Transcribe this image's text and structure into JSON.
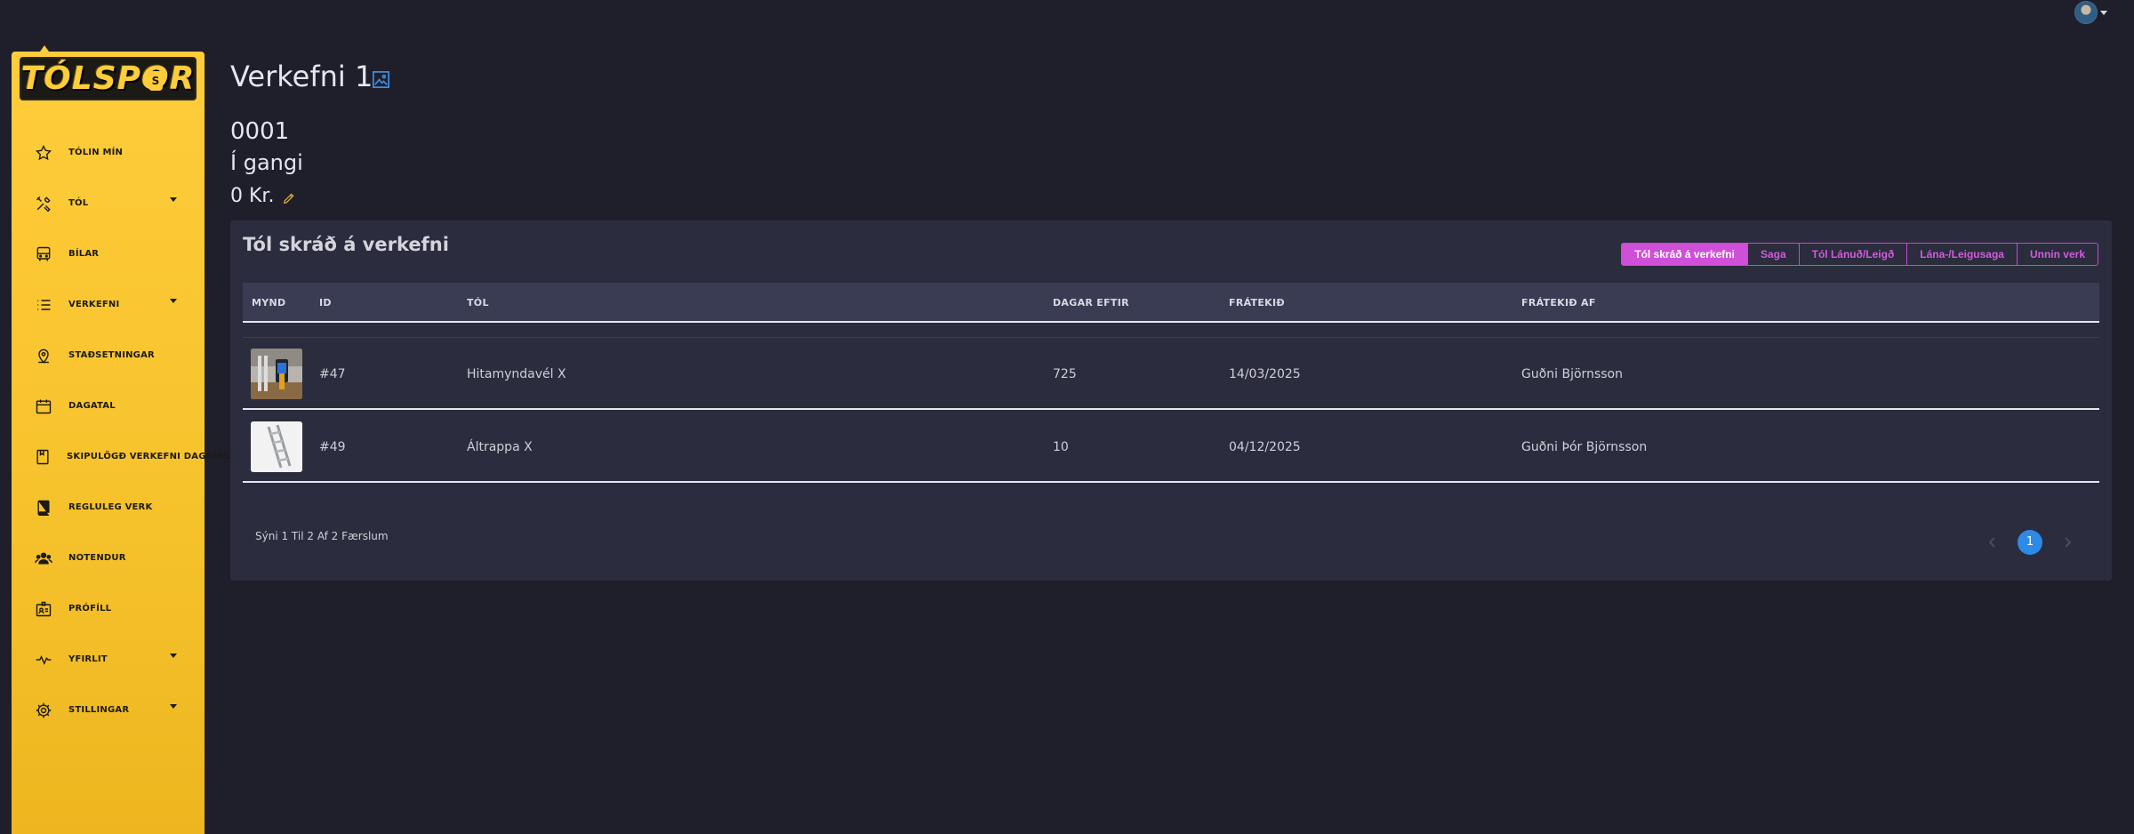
{
  "app": {
    "logo_text": "TÓLSPOR",
    "logo_badge": "S"
  },
  "sidebar": {
    "items": [
      {
        "label": "TÓLIN MÍN",
        "icon": "star-icon"
      },
      {
        "label": "TÓL",
        "icon": "tools-icon",
        "dropdown": true
      },
      {
        "label": "BÍLAR",
        "icon": "bus-icon"
      },
      {
        "label": "VERKEFNI",
        "icon": "list-icon",
        "dropdown": true
      },
      {
        "label": "STAÐSETNINGAR",
        "icon": "location-icon"
      },
      {
        "label": "DAGATAL",
        "icon": "calendar-icon"
      },
      {
        "label": "SKIPULÖGÐ VERKEFNI DAGSINS",
        "icon": "clipboard-icon"
      },
      {
        "label": "REGLULEG VERK",
        "icon": "book-icon"
      },
      {
        "label": "NOTENDUR",
        "icon": "users-icon"
      },
      {
        "label": "PRÓFÍLL",
        "icon": "id-card-icon"
      },
      {
        "label": "YFIRLIT",
        "icon": "activity-icon",
        "dropdown": true
      },
      {
        "label": "STILLINGAR",
        "icon": "gear-icon",
        "dropdown": true
      }
    ]
  },
  "header": {
    "title": "Verkefni 1",
    "number": "0001",
    "status": "Í gangi",
    "price": "0 Kr."
  },
  "card": {
    "title": "Tól skráð á verkefni",
    "tabs": [
      "Tól skráð á verkefni",
      "Saga",
      "Tól Lánuð/Leigð",
      "Lána-/Leigusaga",
      "Unnin verk"
    ],
    "active_tab": "Tól skráð á verkefni",
    "columns": [
      "MYND",
      "ID",
      "TÓL",
      "DAGAR EFTIR",
      "FRÁTEKIÐ",
      "FRÁTEKIÐ AF"
    ],
    "rows": [
      {
        "id": "#47",
        "tool": "Hitamyndavél X",
        "days_left": "725",
        "reserved": "14/03/2025",
        "reserved_by": "Guðni Björnsson"
      },
      {
        "id": "#49",
        "tool": "Áltrappa X",
        "days_left": "10",
        "reserved": "04/12/2025",
        "reserved_by": "Guðni Þór Björnsson"
      }
    ],
    "footer_info": "Sýni 1 Til 2 Af 2 Færslum",
    "current_page": "1"
  },
  "colors": {
    "accent": "#d04fd8",
    "sidebar": "#ffcd3a",
    "page_active": "#2d8ae6",
    "background": "#1f1f2c"
  }
}
